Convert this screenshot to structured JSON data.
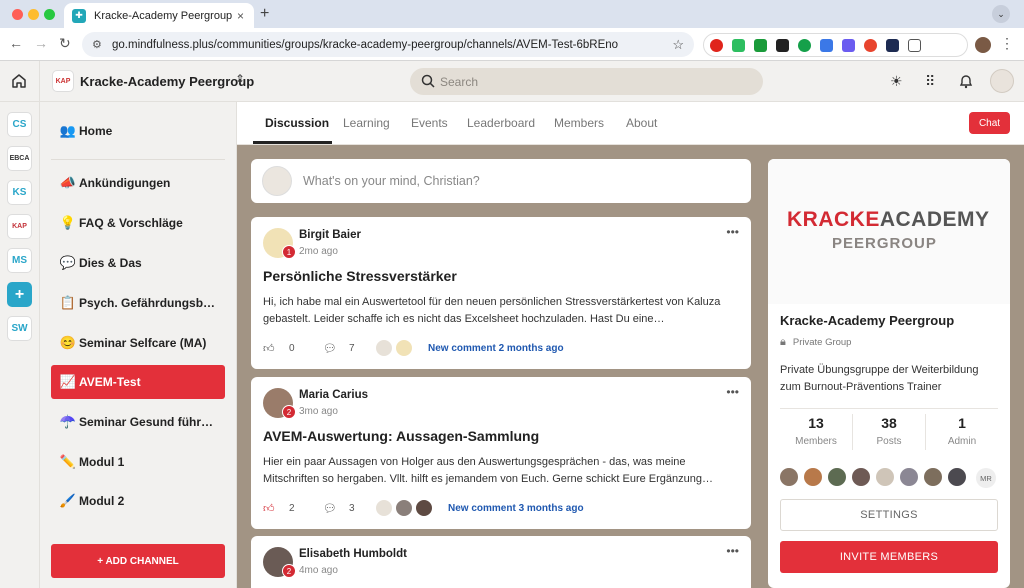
{
  "browser": {
    "tab_title": "Kracke-Academy Peergroup",
    "tab_close": "×",
    "new_tab": "+",
    "url": "go.mindfulness.plus/communities/groups/kracke-academy-peergroup/channels/AVEM-Test-6bREno",
    "colors": {
      "close": "#ff5f57",
      "min": "#febc2e",
      "max": "#28c840"
    }
  },
  "header": {
    "group_title": "Kracke-Academy Peergroup",
    "logo_text": "KAP",
    "search_placeholder": "Search"
  },
  "rail": [
    {
      "label": "CS",
      "color": "#2aa6c9"
    },
    {
      "label": "EBCA",
      "color": "#333333"
    },
    {
      "label": "KS",
      "color": "#2aa6c9"
    },
    {
      "label": "KAP",
      "color": "#c4343b"
    },
    {
      "label": "MS",
      "color": "#2aa6c9"
    },
    {
      "label": "+",
      "color": "#2aa6c9"
    },
    {
      "label": "SW",
      "color": "#2aa6c9"
    }
  ],
  "sidebar": {
    "items": [
      {
        "icon": "👥",
        "label": "Home"
      },
      {
        "icon": "📣",
        "label": "Ankündigungen"
      },
      {
        "icon": "💡",
        "label": "FAQ & Vorschläge"
      },
      {
        "icon": "💬",
        "label": "Dies & Das"
      },
      {
        "icon": "📋",
        "label": "Psych. Gefährdungsb…"
      },
      {
        "icon": "😊",
        "label": "Seminar Selfcare (MA)"
      },
      {
        "icon": "📈",
        "label": "AVEM-Test"
      },
      {
        "icon": "☂️",
        "label": "Seminar Gesund führ…"
      },
      {
        "icon": "✏️",
        "label": "Modul 1"
      },
      {
        "icon": "🖌️",
        "label": "Modul 2"
      }
    ],
    "add_channel": "+ ADD CHANNEL"
  },
  "tabs": [
    "Discussion",
    "Learning",
    "Events",
    "Leaderboard",
    "Members",
    "About"
  ],
  "chat_label": "Chat",
  "composer": {
    "placeholder": "What's on your mind, Christian?"
  },
  "posts": [
    {
      "author": "Birgit Baier",
      "badge": "1",
      "time": "2mo ago",
      "title": "Persönliche Stressverstärker",
      "body": "Hi, ich habe mal ein Auswertetool für den neuen persönlichen Stressverstärkertest von Kaluza gebastelt. Leider schaffe ich es nicht das Excelsheet hochzuladen. Hast Du eine…",
      "likes": "0",
      "comments": "7",
      "new_comment": "New comment 2 months ago"
    },
    {
      "author": "Maria Carius",
      "badge": "2",
      "time": "3mo ago",
      "title": "AVEM-Auswertung: Aussagen-Sammlung",
      "body": "Hier ein paar Aussagen von Holger aus den Auswertungsgesprächen - das, was meine Mitschriften so hergaben. Vllt. hilft es jemandem von Euch. Gerne schickt Eure Ergänzung…",
      "likes": "2",
      "comments": "3",
      "new_comment": "New comment 3 months ago"
    },
    {
      "author": "Elisabeth Humboldt",
      "badge": "2",
      "time": "4mo ago"
    }
  ],
  "about": {
    "brand_line1_a": "KRACKE",
    "brand_line1_b": "ACADEMY",
    "brand_line2": "PEERGROUP",
    "name": "Kracke-Academy Peergroup",
    "privacy": "Private Group",
    "description": "Private Übungsgruppe der Weiterbildung zum Burnout-Präventions Trainer",
    "stats": [
      {
        "value": "13",
        "label": "Members"
      },
      {
        "value": "38",
        "label": "Posts"
      },
      {
        "value": "1",
        "label": "Admin"
      }
    ],
    "more_members": "MR",
    "settings": "SETTINGS",
    "invite": "INVITE MEMBERS"
  }
}
